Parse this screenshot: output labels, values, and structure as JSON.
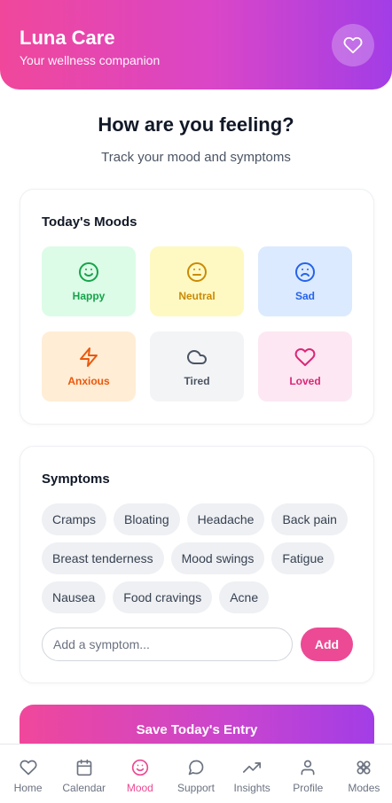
{
  "header": {
    "title": "Luna Care",
    "subtitle": "Your wellness companion",
    "icon": "heart-icon"
  },
  "main": {
    "title": "How are you feeling?",
    "subtitle": "Track your mood and symptoms"
  },
  "moods": {
    "title": "Today's Moods",
    "items": [
      {
        "label": "Happy",
        "icon": "smile-icon",
        "color": "#16a34a",
        "bg": "#dcfce7"
      },
      {
        "label": "Neutral",
        "icon": "neutral-face-icon",
        "color": "#ca8a04",
        "bg": "#fef9c3"
      },
      {
        "label": "Sad",
        "icon": "sad-face-icon",
        "color": "#2563eb",
        "bg": "#dbeafe"
      },
      {
        "label": "Anxious",
        "icon": "lightning-icon",
        "color": "#ea580c",
        "bg": "#ffedd5"
      },
      {
        "label": "Tired",
        "icon": "cloud-icon",
        "color": "#4b5563",
        "bg": "#f3f4f6"
      },
      {
        "label": "Loved",
        "icon": "heart-icon",
        "color": "#db2777",
        "bg": "#fce7f3"
      }
    ]
  },
  "symptoms": {
    "title": "Symptoms",
    "chips": [
      "Cramps",
      "Bloating",
      "Headache",
      "Back pain",
      "Breast tenderness",
      "Mood swings",
      "Fatigue",
      "Nausea",
      "Food cravings",
      "Acne"
    ],
    "input_placeholder": "Add a symptom...",
    "add_label": "Add"
  },
  "save_label": "Save Today's Entry",
  "nav": {
    "items": [
      {
        "label": "Home",
        "icon": "heart-icon",
        "active": false
      },
      {
        "label": "Calendar",
        "icon": "calendar-icon",
        "active": false
      },
      {
        "label": "Mood",
        "icon": "smile-icon",
        "active": true
      },
      {
        "label": "Support",
        "icon": "chat-bubble-icon",
        "active": false
      },
      {
        "label": "Insights",
        "icon": "trending-up-icon",
        "active": false
      },
      {
        "label": "Profile",
        "icon": "user-icon",
        "active": false
      },
      {
        "label": "Modes",
        "icon": "flower-icon",
        "active": false
      }
    ]
  },
  "colors": {
    "accent": "#ec4a94",
    "gradient_start": "#f0479b",
    "gradient_end": "#a23de6"
  }
}
